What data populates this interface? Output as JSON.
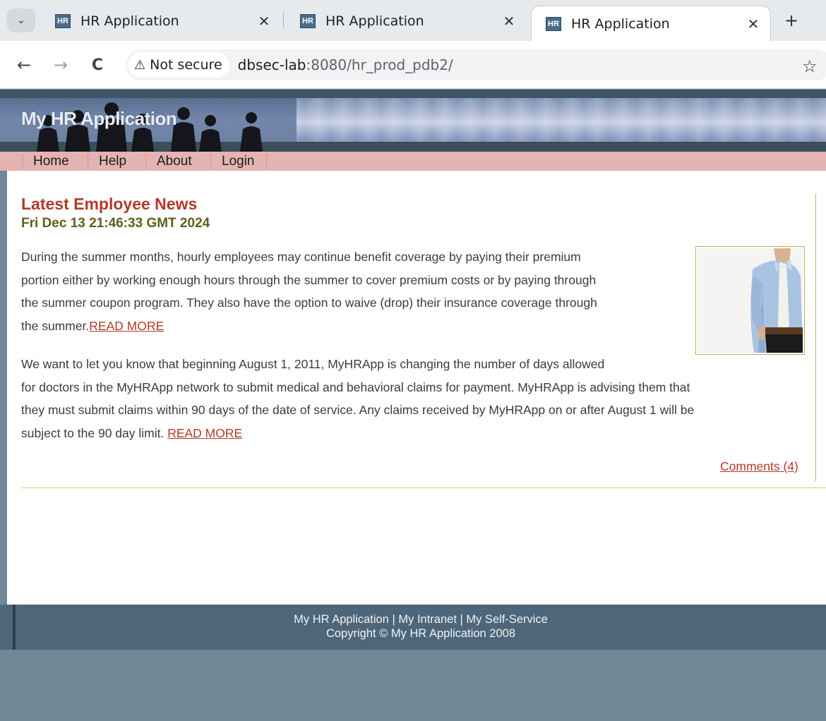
{
  "browser": {
    "tabs": [
      {
        "favicon": "HR",
        "title": "HR Application",
        "close": "✕",
        "active": false
      },
      {
        "favicon": "HR",
        "title": "HR Application",
        "close": "✕",
        "active": false
      },
      {
        "favicon": "HR",
        "title": "HR Application",
        "close": "✕",
        "active": true
      }
    ],
    "new_tab": "+",
    "tab_menu": "⌄",
    "back": "←",
    "forward": "→",
    "reload": "C",
    "security": {
      "icon": "warning-triangle-icon",
      "glyph": "⚠",
      "label": "Not secure"
    },
    "url": {
      "host": "dbsec-lab",
      "path": ":8080/hr_prod_pdb2/"
    },
    "bookmark": "☆"
  },
  "site": {
    "banner_title": "My HR Application",
    "nav": [
      {
        "label": "Home"
      },
      {
        "label": "Help"
      },
      {
        "label": "About"
      },
      {
        "label": "Login"
      }
    ]
  },
  "news": {
    "title": "Latest Employee News",
    "date": "Fri Dec 13 21:46:33 GMT 2024",
    "p1_lines": [
      "During the summer months, hourly employees may continue benefit coverage by paying their premium",
      "portion either by working enough hours through the summer to cover premium costs or by paying through",
      "the summer coupon program. They also have the option to waive (drop) their insurance coverage through",
      "the summer."
    ],
    "p1_link": "READ MORE",
    "p2_lines": [
      "We want to let you know that beginning August 1, 2011, MyHRApp is changing the number of days allowed",
      "for doctors in the MyHRApp network to submit medical and behavioral claims for payment.  MyHRApp is advising them that",
      "they must submit claims within 90 days of the date of service.  Any claims received by MyHRApp on or after August 1 will be",
      "subject to the 90 day limit. "
    ],
    "p2_link": "READ MORE",
    "comments": "Comments (4)"
  },
  "footer": {
    "line1": "My HR Application | My Intranet | My Self-Service",
    "line2": "Copyright © My HR Application 2008"
  },
  "colors": {
    "accent_red": "#b5392a",
    "date_olive": "#5e6019",
    "menu_bar": "#e4b3b2",
    "page_bg": "#6e8896",
    "footer_bg": "#4f677a"
  }
}
